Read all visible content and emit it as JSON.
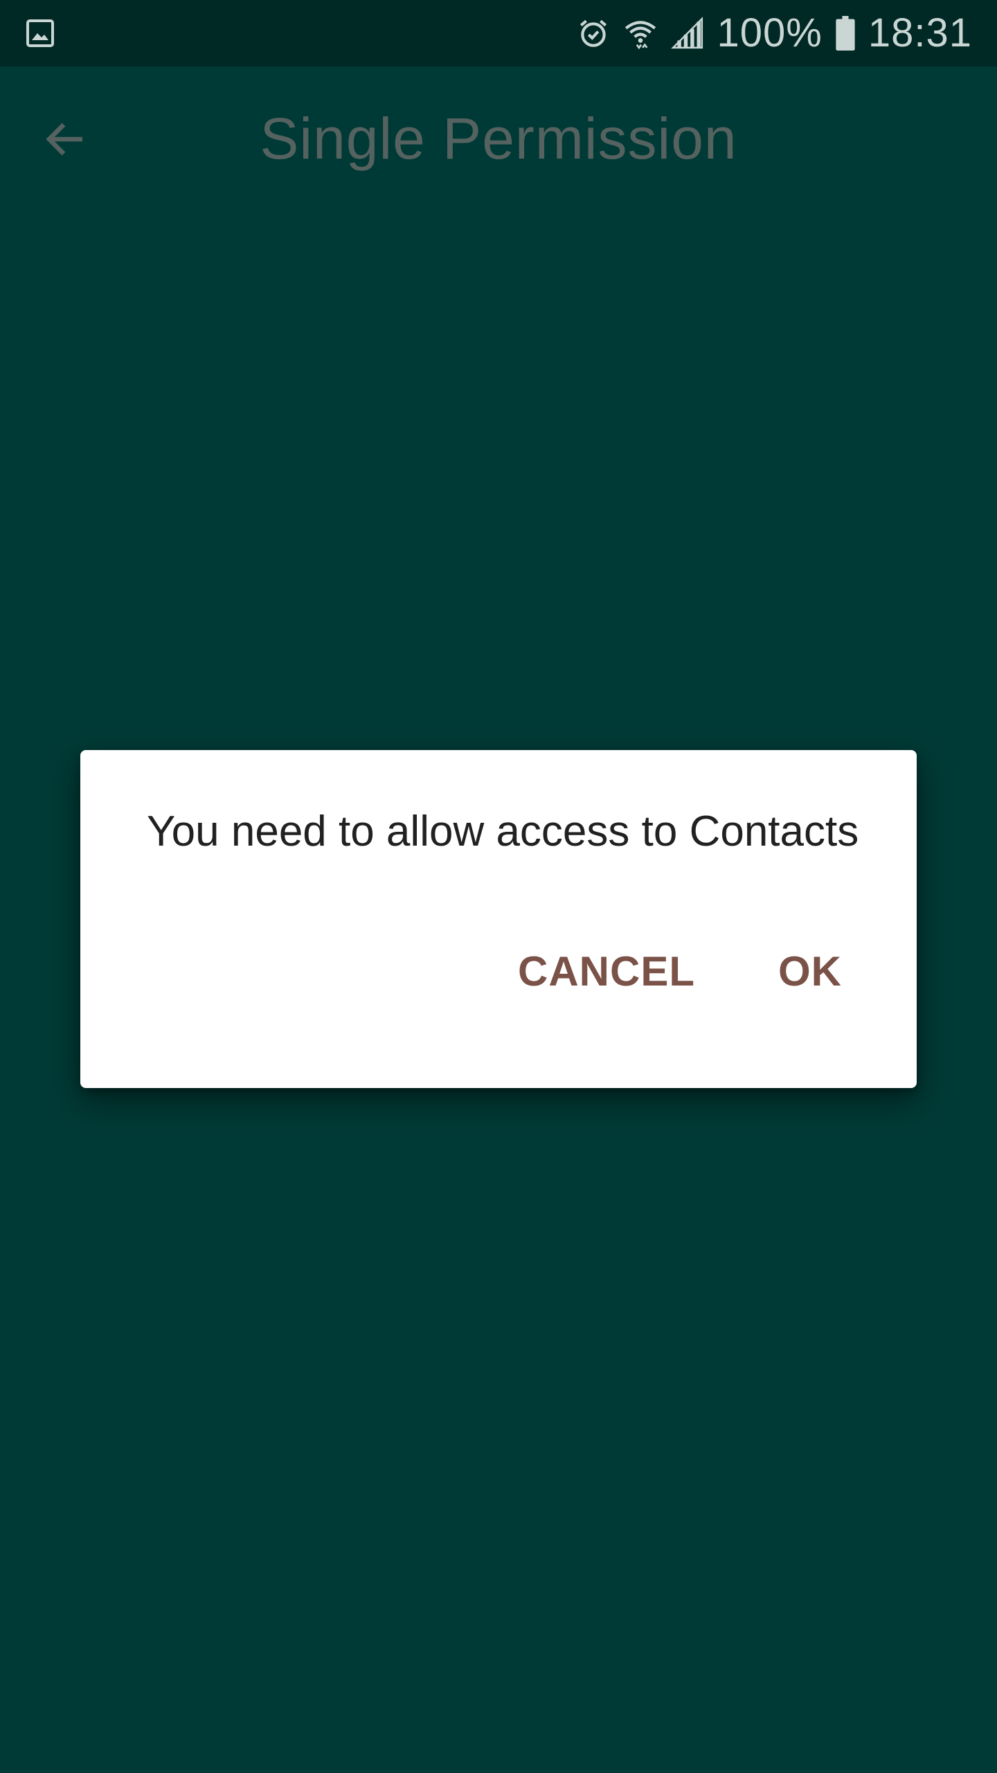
{
  "status_bar": {
    "left_icon": "gallery-notification-icon",
    "icons": [
      "alarm-icon",
      "wifi-icon",
      "signal-icon"
    ],
    "battery_percent_label": "100%",
    "battery_icon": "battery-icon",
    "time": "18:31"
  },
  "app_bar": {
    "back_icon": "arrow-back-icon",
    "title": "Single Permission"
  },
  "dialog": {
    "message": "You need to allow access to Contacts",
    "cancel_label": "CANCEL",
    "ok_label": "OK",
    "accent_color": "#7a5247"
  },
  "colors": {
    "status_bar": "#002824",
    "background": "#003a36"
  }
}
